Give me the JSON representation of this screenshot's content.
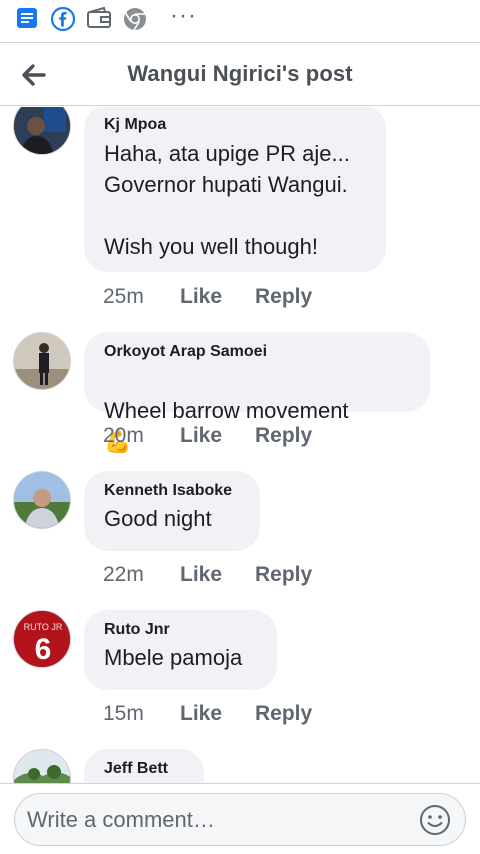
{
  "status_bar": {
    "icons": [
      "notes-icon",
      "facebook-icon",
      "wallet-icon",
      "chrome-icon",
      "more-dots-icon"
    ],
    "more_glyph": "···"
  },
  "header": {
    "title": "Wangui Ngirici's post",
    "back_icon": "arrow-left-icon"
  },
  "comments": [
    {
      "author": "Kj Mpoa",
      "text": "Haha, ata upige PR aje...\nGovernor hupati Wangui.\n\nWish you well though!",
      "time": "25m",
      "like": "Like",
      "reply": "Reply"
    },
    {
      "author": "Orkoyot Arap Samoei",
      "text": "Wheel barrow movement",
      "emoji": "💪",
      "time": "20m",
      "like": "Like",
      "reply": "Reply"
    },
    {
      "author": "Kenneth Isaboke",
      "text": "Good night",
      "time": "22m",
      "like": "Like",
      "reply": "Reply"
    },
    {
      "author": "Ruto Jnr",
      "text": "Mbele pamoja",
      "time": "15m",
      "like": "Like",
      "reply": "Reply",
      "avatar_text": "RUTO JR",
      "avatar_number": "6"
    },
    {
      "author": "Jeff Bett"
    }
  ],
  "composer": {
    "placeholder": "Write a comment…",
    "emoji_icon": "smiley-icon"
  },
  "colors": {
    "facebook_blue": "#1877f2",
    "bubble_bg": "#f0f2f5",
    "meta_gray": "#606770"
  }
}
